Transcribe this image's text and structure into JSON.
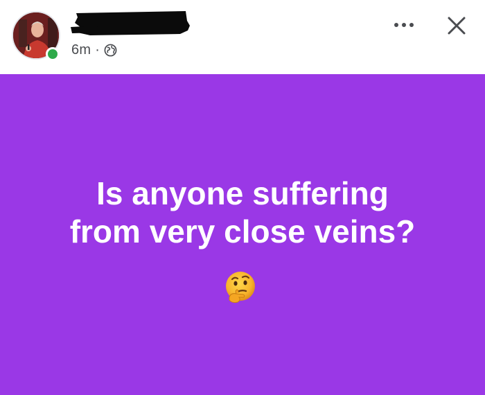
{
  "post": {
    "time": "6m",
    "separator": "·",
    "privacy_icon": "globe-icon",
    "author_name_redacted": true,
    "lines": [
      "Is anyone suffering",
      "from very close veins?"
    ],
    "emoji": "thinking-face-icon",
    "background_color": "#9a38e6",
    "text_color": "#ffffff"
  },
  "header": {
    "more_icon": "more-options-icon",
    "close_icon": "close-icon",
    "online_status_color": "#2eaa4a"
  }
}
